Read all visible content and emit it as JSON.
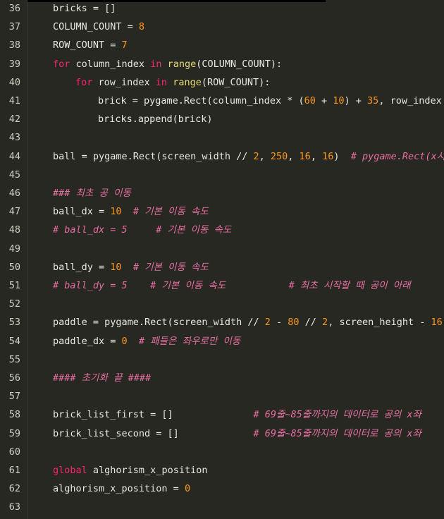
{
  "editor": {
    "colors": {
      "background": "#272822",
      "text": "#e8e8e2",
      "line_number": "#cfcfc2",
      "keyword": "#f92672",
      "builtin": "#e6db74",
      "number": "#fd971f",
      "comment": "#e76ea2"
    },
    "lines": [
      {
        "n": "36",
        "indent": 0,
        "tokens": [
          [
            "id",
            "bricks = []"
          ]
        ]
      },
      {
        "n": "37",
        "indent": 0,
        "tokens": [
          [
            "id",
            "COLUMN_COUNT = "
          ],
          [
            "num",
            "8"
          ]
        ]
      },
      {
        "n": "38",
        "indent": 0,
        "tokens": [
          [
            "id",
            "ROW_COUNT = "
          ],
          [
            "num",
            "7"
          ]
        ]
      },
      {
        "n": "39",
        "indent": 0,
        "tokens": [
          [
            "kw",
            "for"
          ],
          [
            "id",
            " column_index "
          ],
          [
            "kw",
            "in"
          ],
          [
            "id",
            " "
          ],
          [
            "fn",
            "range"
          ],
          [
            "id",
            "(COLUMN_COUNT):"
          ]
        ]
      },
      {
        "n": "40",
        "indent": 1,
        "tokens": [
          [
            "kw",
            "for"
          ],
          [
            "id",
            " row_index "
          ],
          [
            "kw",
            "in"
          ],
          [
            "id",
            " "
          ],
          [
            "fn",
            "range"
          ],
          [
            "id",
            "(ROW_COUNT):"
          ]
        ]
      },
      {
        "n": "41",
        "indent": 2,
        "tokens": [
          [
            "id",
            "brick = pygame.Rect(column_index * ("
          ],
          [
            "num",
            "60"
          ],
          [
            "id",
            " + "
          ],
          [
            "num",
            "10"
          ],
          [
            "id",
            ") + "
          ],
          [
            "num",
            "35"
          ],
          [
            "id",
            ", row_index * ("
          ]
        ]
      },
      {
        "n": "42",
        "indent": 2,
        "tokens": [
          [
            "id",
            "bricks.append(brick)"
          ]
        ]
      },
      {
        "n": "43",
        "indent": 0,
        "tokens": []
      },
      {
        "n": "44",
        "indent": 0,
        "tokens": [
          [
            "id",
            "ball = pygame.Rect(screen_width // "
          ],
          [
            "num",
            "2"
          ],
          [
            "id",
            ", "
          ],
          [
            "num",
            "250"
          ],
          [
            "id",
            ", "
          ],
          [
            "num",
            "16"
          ],
          [
            "id",
            ", "
          ],
          [
            "num",
            "16"
          ],
          [
            "id",
            ")  "
          ],
          [
            "com",
            "# pygame.Rect(x시"
          ]
        ]
      },
      {
        "n": "45",
        "indent": 0,
        "tokens": []
      },
      {
        "n": "46",
        "indent": 0,
        "tokens": [
          [
            "com",
            "### 최초 공 이동"
          ]
        ]
      },
      {
        "n": "47",
        "indent": 0,
        "tokens": [
          [
            "id",
            "ball_dx = "
          ],
          [
            "num",
            "10"
          ],
          [
            "id",
            "  "
          ],
          [
            "com",
            "# 기본 이동 속도"
          ]
        ]
      },
      {
        "n": "48",
        "indent": 0,
        "tokens": [
          [
            "com",
            "# ball_dx = 5     # 기본 이동 속도"
          ]
        ]
      },
      {
        "n": "49",
        "indent": 0,
        "tokens": []
      },
      {
        "n": "50",
        "indent": 0,
        "tokens": [
          [
            "id",
            "ball_dy = "
          ],
          [
            "num",
            "10"
          ],
          [
            "id",
            "  "
          ],
          [
            "com",
            "# 기본 이동 속도"
          ]
        ]
      },
      {
        "n": "51",
        "indent": 0,
        "tokens": [
          [
            "com",
            "# ball_dy = 5    # 기본 이동 속도           # 최초 시작할 때 공이 아래"
          ]
        ]
      },
      {
        "n": "52",
        "indent": 0,
        "tokens": []
      },
      {
        "n": "53",
        "indent": 0,
        "tokens": [
          [
            "id",
            "paddle = pygame.Rect(screen_width // "
          ],
          [
            "num",
            "2"
          ],
          [
            "id",
            " - "
          ],
          [
            "num",
            "80"
          ],
          [
            "id",
            " // "
          ],
          [
            "num",
            "2"
          ],
          [
            "id",
            ", screen_height - "
          ],
          [
            "num",
            "16"
          ],
          [
            "id",
            ", "
          ]
        ]
      },
      {
        "n": "54",
        "indent": 0,
        "tokens": [
          [
            "id",
            "paddle_dx = "
          ],
          [
            "num",
            "0"
          ],
          [
            "id",
            "  "
          ],
          [
            "com",
            "# 패들은 좌우로만 이동"
          ]
        ]
      },
      {
        "n": "55",
        "indent": 0,
        "tokens": []
      },
      {
        "n": "56",
        "indent": 0,
        "tokens": [
          [
            "com",
            "#### 초기화 끝 ####"
          ]
        ]
      },
      {
        "n": "57",
        "indent": 0,
        "tokens": []
      },
      {
        "n": "58",
        "indent": 0,
        "tokens": [
          [
            "id",
            "brick_list_first = []              "
          ],
          [
            "com",
            "# 69줄~85줄까지의 데이터로 공의 x좌"
          ]
        ]
      },
      {
        "n": "59",
        "indent": 0,
        "tokens": [
          [
            "id",
            "brick_list_second = []             "
          ],
          [
            "com",
            "# 69줄~85줄까지의 데이터로 공의 x좌"
          ]
        ]
      },
      {
        "n": "60",
        "indent": 0,
        "tokens": []
      },
      {
        "n": "61",
        "indent": 0,
        "tokens": [
          [
            "kw",
            "global"
          ],
          [
            "id",
            " alghorism_x_position"
          ]
        ]
      },
      {
        "n": "62",
        "indent": 0,
        "tokens": [
          [
            "id",
            "alghorism_x_position = "
          ],
          [
            "num",
            "0"
          ]
        ]
      },
      {
        "n": "63",
        "indent": 0,
        "tokens": []
      }
    ]
  }
}
